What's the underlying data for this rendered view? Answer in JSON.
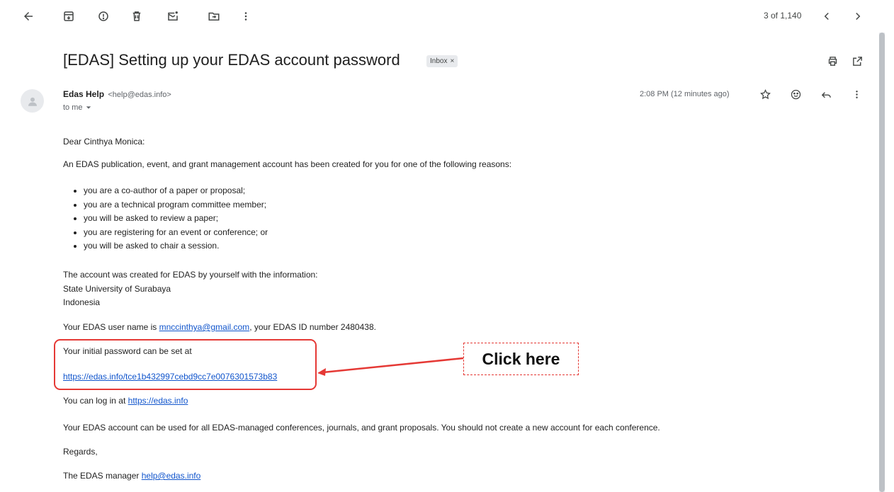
{
  "toolbar": {
    "icons": [
      "back-arrow-icon",
      "archive-icon",
      "report-spam-icon",
      "delete-icon",
      "mark-unread-icon",
      "move-to-icon",
      "more-vert-icon"
    ],
    "pager_text": "3 of 1,140"
  },
  "email": {
    "subject": "[EDAS] Setting up your EDAS account password",
    "label": "Inbox",
    "label_close": "×",
    "sender_name": "Edas Help",
    "sender_address": "<help@edas.info>",
    "recipient": "to me",
    "time": "2:08 PM (12 minutes ago)"
  },
  "body": {
    "greeting": "Dear Cinthya Monica:",
    "intro": "An EDAS publication, event, and grant management account has been created for you for one of the following reasons:",
    "reasons": [
      "you are a co-author of a paper or proposal;",
      "you are a technical program committee member;",
      "you will be asked to review a paper;",
      "you are registering for an event or conference; or",
      "you will be asked to chair a session."
    ],
    "created_line": "The account was created for EDAS by yourself with the information:",
    "university": "State University of Surabaya",
    "country": "Indonesia",
    "username_prefix": "Your EDAS user name is ",
    "username_email": "mnccinthya@gmail.com",
    "username_suffix": ", your EDAS ID number 2480438.",
    "password_line": "Your initial password can be set at",
    "password_link": "https://edas.info/tce1b432997cebd9cc7e0076301573b83",
    "login_prefix": "You can log in at ",
    "login_link": "https://edas.info",
    "account_note": "Your EDAS account can be used for all EDAS-managed conferences, journals, and grant proposals. You should not create a new account for each conference.",
    "regards": "Regards,",
    "manager_prefix": "The EDAS manager ",
    "manager_email": "help@edas.info"
  },
  "annotation": {
    "callout_text": "Click here",
    "color": "#e53935"
  },
  "colors": {
    "link": "#1155cc",
    "chip_bg": "#e8eaed"
  }
}
